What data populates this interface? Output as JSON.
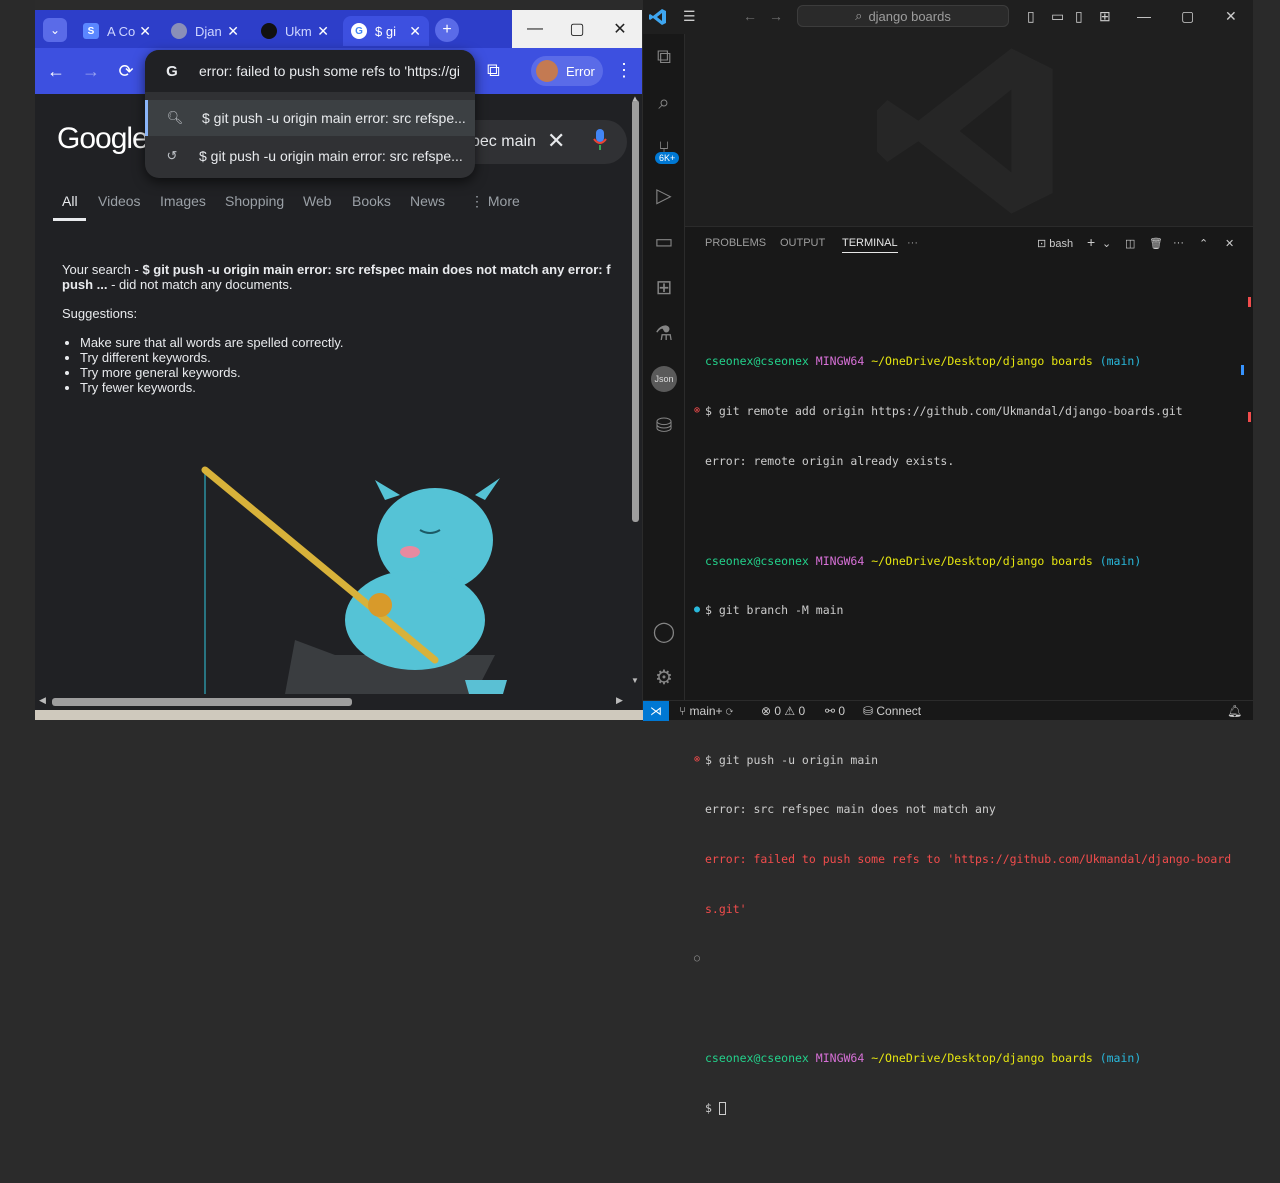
{
  "chrome": {
    "tabs": [
      {
        "label": "A Co",
        "favicon": "S"
      },
      {
        "label": "Djan",
        "favicon": ""
      },
      {
        "label": "Ukm",
        "favicon": ""
      },
      {
        "label": "$ gi",
        "favicon": "G"
      }
    ],
    "omnibox": {
      "value": "error: failed to push some refs to 'https://gi",
      "suggestions": [
        "$ git push -u origin main error: src refspe...",
        "$ git push -u origin main error: src refspe..."
      ]
    },
    "profile_label": "Error"
  },
  "google": {
    "logo": "Google",
    "search_value": "pec main",
    "tabs": [
      "All",
      "Videos",
      "Images",
      "Shopping",
      "Web",
      "Books",
      "News",
      "More"
    ],
    "results": {
      "prefix": "Your search - ",
      "query": "$ git push -u origin main error: src refspec main does not match any error: f",
      "query_cont": "push ...",
      "suffix": " - did not match any documents.",
      "suggestions_heading": "Suggestions:",
      "suggestions": [
        "Make sure that all words are spelled correctly.",
        "Try different keywords.",
        "Try more general keywords.",
        "Try fewer keywords."
      ]
    }
  },
  "vscode": {
    "search": "django boards",
    "panel_tabs": [
      "PROBLEMS",
      "OUTPUT",
      "TERMINAL"
    ],
    "terminal_name": "bash",
    "prompt": {
      "user": "cseonex@cseonex",
      "sys": "MINGW64",
      "path": "~/OneDrive/Desktop/django boards",
      "branch": "(main)"
    },
    "commands": [
      {
        "cmd": "$ git remote add origin https://github.com/Ukmandal/django-boards.git",
        "out": [
          "error: remote origin already exists."
        ],
        "err": []
      },
      {
        "cmd": "$ git branch -M main",
        "out": [],
        "err": []
      },
      {
        "cmd": "$ git push -u origin main",
        "out": [
          "error: src refspec main does not match any"
        ],
        "err": [
          "error: failed to push some refs to 'https://github.com/Ukmandal/django-board",
          "s.git'"
        ]
      }
    ],
    "last_prompt": "$ ",
    "status": {
      "branch": "main+",
      "errors": "0",
      "warnings": "0",
      "ports": "0",
      "connect": "Connect"
    }
  }
}
